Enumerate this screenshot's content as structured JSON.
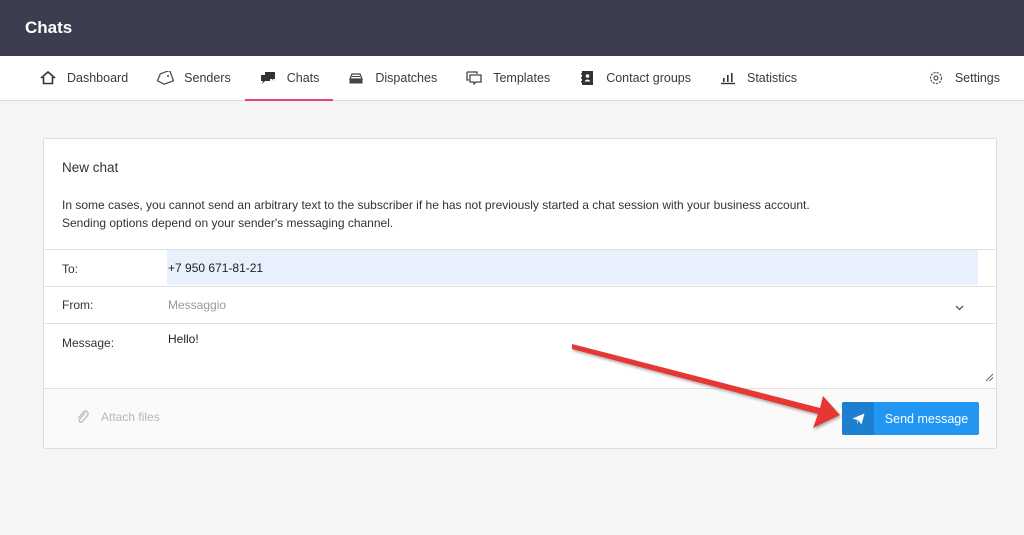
{
  "header": {
    "title": "Chats"
  },
  "nav": {
    "items": [
      {
        "label": "Dashboard",
        "icon": "home-icon"
      },
      {
        "label": "Senders",
        "icon": "tag-icon"
      },
      {
        "label": "Chats",
        "icon": "chat-bubbles-icon",
        "active": true
      },
      {
        "label": "Dispatches",
        "icon": "inbox-tray-icon"
      },
      {
        "label": "Templates",
        "icon": "template-icon"
      },
      {
        "label": "Contact groups",
        "icon": "contact-book-icon"
      },
      {
        "label": "Statistics",
        "icon": "bar-chart-icon"
      }
    ],
    "settings_label": "Settings",
    "active_color": "#e5417b"
  },
  "new_chat": {
    "title": "New chat",
    "description_line1": "In some cases, you cannot send an arbitrary text to the subscriber if he has not previously started a chat session with your business account.",
    "description_line2": "Sending options depend on your sender's messaging channel.",
    "to_label": "To:",
    "to_value": "+7 950 671-81-21",
    "from_label": "From:",
    "from_value": "Messaggio",
    "message_label": "Message:",
    "message_value": "Hello!",
    "attach_label": "Attach files",
    "send_label": "Send message"
  },
  "colors": {
    "topbar": "#3c3e50",
    "send_button": "#2196f3",
    "send_icon_box": "#1c7fd0",
    "annotation_arrow": "#e53935",
    "to_input_bg": "#e8f0fe"
  },
  "annotation": {
    "type": "arrow",
    "points_to": "send-message-button"
  }
}
